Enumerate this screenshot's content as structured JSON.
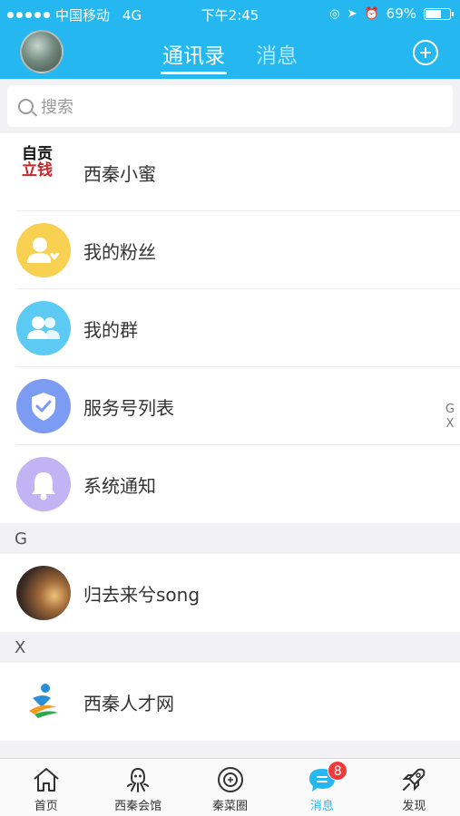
{
  "status_bar": {
    "carrier": "中国移动",
    "network": "4G",
    "time": "下午2:45",
    "battery": "69%",
    "battery_level": 0.69
  },
  "header": {
    "tabs": [
      {
        "label": "通讯录",
        "active": true
      },
      {
        "label": "消息",
        "active": false
      }
    ]
  },
  "search": {
    "placeholder": "搜索"
  },
  "fixed_items": [
    {
      "label": "西秦小蜜",
      "icon": "xiqin-xiaomi-logo"
    },
    {
      "label": "我的粉丝",
      "icon": "fans-icon",
      "color": "#f8d153"
    },
    {
      "label": "我的群",
      "icon": "group-icon",
      "color": "#5ccaf3"
    },
    {
      "label": "服务号列表",
      "icon": "shield-check-icon",
      "color": "#7c9bf3"
    },
    {
      "label": "系统通知",
      "icon": "bell-icon",
      "color": "#c2b3f4"
    }
  ],
  "sections": [
    {
      "letter": "G",
      "contacts": [
        {
          "name": "归去来兮song"
        }
      ]
    },
    {
      "letter": "X",
      "contacts": [
        {
          "name": "西秦人才网"
        }
      ]
    }
  ],
  "logo_text": {
    "line1": "自贡",
    "line2": "立钱"
  },
  "index_bar": [
    "G",
    "X"
  ],
  "bottom_tabs": [
    {
      "label": "首页",
      "icon": "home-icon",
      "active": false
    },
    {
      "label": "西秦会馆",
      "icon": "octopus-icon",
      "active": false
    },
    {
      "label": "秦菜圈",
      "icon": "camera-lens-icon",
      "active": false
    },
    {
      "label": "消息",
      "icon": "chat-bubble-icon",
      "active": true,
      "badge": "8"
    },
    {
      "label": "发现",
      "icon": "rocket-icon",
      "active": false
    }
  ],
  "colors": {
    "accent": "#25b8f0",
    "badge": "#ee3a3a"
  }
}
